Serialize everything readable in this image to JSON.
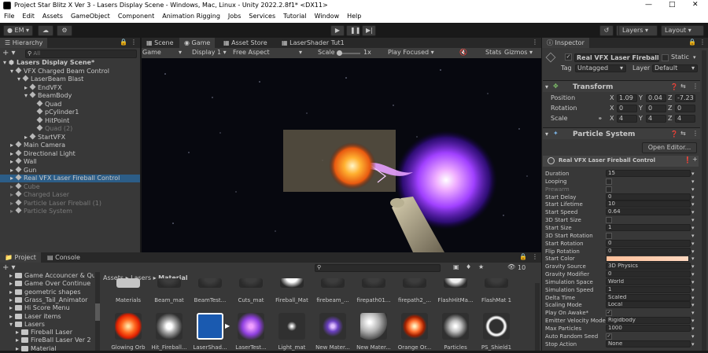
{
  "window": {
    "title": "Project Star Blitz X Ver 3 - Lasers Display Scene - Windows, Mac, Linux - Unity 2022.2.8f1* <DX11>"
  },
  "menu": [
    "File",
    "Edit",
    "Assets",
    "GameObject",
    "Component",
    "Animation Rigging",
    "Jobs",
    "Services",
    "Tutorial",
    "Window",
    "Help"
  ],
  "toolbar": {
    "account": "EM",
    "layers": "Layers",
    "layout": "Layout"
  },
  "hierarchy": {
    "tab": "Hierarchy",
    "search_placeholder": "All",
    "items": [
      {
        "label": "Lasers Display Scene*",
        "depth": 0,
        "kind": "scene",
        "state": "normal"
      },
      {
        "label": "VFX Charged Beam Control",
        "depth": 1,
        "kind": "object",
        "state": "normal"
      },
      {
        "label": "LaserBeam Blast",
        "depth": 2,
        "kind": "object",
        "state": "normal"
      },
      {
        "label": "EndVFX",
        "depth": 3,
        "kind": "object",
        "state": "normal"
      },
      {
        "label": "BeamBody",
        "depth": 3,
        "kind": "object",
        "state": "normal"
      },
      {
        "label": "Quad",
        "depth": 4,
        "kind": "object",
        "state": "normal"
      },
      {
        "label": "pCylinder1",
        "depth": 4,
        "kind": "object",
        "state": "normal"
      },
      {
        "label": "HitPoint",
        "depth": 4,
        "kind": "object",
        "state": "normal"
      },
      {
        "label": "Quad (2)",
        "depth": 4,
        "kind": "object",
        "state": "dim"
      },
      {
        "label": "StartVFX",
        "depth": 3,
        "kind": "object",
        "state": "normal"
      },
      {
        "label": "Main Camera",
        "depth": 1,
        "kind": "object",
        "state": "normal"
      },
      {
        "label": "Directional Light",
        "depth": 1,
        "kind": "object",
        "state": "normal"
      },
      {
        "label": "Wall",
        "depth": 1,
        "kind": "object",
        "state": "normal"
      },
      {
        "label": "Gun",
        "depth": 1,
        "kind": "object",
        "state": "normal"
      },
      {
        "label": "Real VFX Laser Fireball Control",
        "depth": 1,
        "kind": "object",
        "state": "selected"
      },
      {
        "label": "Cube",
        "depth": 1,
        "kind": "object",
        "state": "dim"
      },
      {
        "label": "Charged Laser",
        "depth": 1,
        "kind": "object",
        "state": "dim"
      },
      {
        "label": "Particle Laser Fireball  (1)",
        "depth": 1,
        "kind": "object",
        "state": "dim"
      },
      {
        "label": "Particle System",
        "depth": 1,
        "kind": "object",
        "state": "dim"
      }
    ]
  },
  "view_tabs": [
    "Scene",
    "Game",
    "Asset Store",
    "LaserShader Tut1"
  ],
  "game_bar": {
    "mode": "Game",
    "display": "Display 1",
    "aspect": "Free Aspect",
    "scale_label": "Scale",
    "scale_value": "1x",
    "play_focused": "Play Focused",
    "stats": "Stats",
    "gizmos": "Gizmos"
  },
  "inspector": {
    "tab": "Inspector",
    "object_name": "Real VFX Laser Fireball Cor",
    "static_label": "Static",
    "tag_label": "Tag",
    "tag_value": "Untagged",
    "layer_label": "Layer",
    "layer_value": "Default",
    "transform": {
      "title": "Transform",
      "rows": [
        {
          "label": "Position",
          "x": "1.09",
          "y": "0.04",
          "z": "-7.23"
        },
        {
          "label": "Rotation",
          "x": "0",
          "y": "0",
          "z": "0"
        },
        {
          "label": "Scale",
          "x": "4",
          "y": "4",
          "z": "4"
        }
      ]
    },
    "particle_system": {
      "title": "Particle System",
      "open_editor": "Open Editor...",
      "sub_title": "Real VFX Laser Fireball Control",
      "props": [
        {
          "label": "Duration",
          "value": "15"
        },
        {
          "label": "Looping",
          "value": ""
        },
        {
          "label": "Prewarm",
          "value": ""
        },
        {
          "label": "Start Delay",
          "value": "0"
        },
        {
          "label": "Start Lifetime",
          "value": "10"
        },
        {
          "label": "Start Speed",
          "value": "0.64"
        },
        {
          "label": "3D Start Size",
          "value": ""
        },
        {
          "label": "Start Size",
          "value": "1"
        },
        {
          "label": "3D Start Rotation",
          "value": ""
        },
        {
          "label": "Start Rotation",
          "value": "0"
        },
        {
          "label": "Flip Rotation",
          "value": "0"
        },
        {
          "label": "Start Color",
          "value": ""
        },
        {
          "label": "Gravity Source",
          "value": "3D Physics"
        },
        {
          "label": "Gravity Modifier",
          "value": "0"
        },
        {
          "label": "Simulation Space",
          "value": "World"
        },
        {
          "label": "Simulation Speed",
          "value": "1"
        },
        {
          "label": "Delta Time",
          "value": "Scaled"
        },
        {
          "label": "Scaling Mode",
          "value": "Local"
        },
        {
          "label": "Play On Awake*",
          "value": ""
        },
        {
          "label": "Emitter Velocity Mode",
          "value": "Rigidbody"
        },
        {
          "label": "Max Particles",
          "value": "1000"
        },
        {
          "label": "Auto Random Seed",
          "value": ""
        },
        {
          "label": "Stop Action",
          "value": "None"
        }
      ]
    }
  },
  "project": {
    "tabs": [
      "Project",
      "Console"
    ],
    "badge": "10",
    "breadcrumb": [
      "Assets",
      "Lasers",
      "Material"
    ],
    "folders": [
      {
        "label": "Game Accouncer & Quo",
        "depth": 1
      },
      {
        "label": "Game Over Continue",
        "depth": 1
      },
      {
        "label": "geometric shapes",
        "depth": 1
      },
      {
        "label": "Grass_Tail_Animator",
        "depth": 1
      },
      {
        "label": "Hi Score Menu",
        "depth": 1
      },
      {
        "label": "Laser items",
        "depth": 1
      },
      {
        "label": "Lasers",
        "depth": 1
      },
      {
        "label": "Fireball Laser",
        "depth": 2
      },
      {
        "label": "FireBall Laser Ver 2",
        "depth": 2
      },
      {
        "label": "Material",
        "depth": 2
      }
    ],
    "assets_row1": [
      "Materials",
      "Beam_mat",
      "BeamTest...",
      "Cuts_mat",
      "Fireball_Mat",
      "firebeam_...",
      "firepath01...",
      "firepath2_...",
      "FlashHitMa...",
      "FlashMat 1"
    ],
    "assets_row2": [
      "Glowing Orb",
      "Hit_Fireball...",
      "LaserShad...",
      "LaserTest...",
      "Light_mat",
      "New Mater...",
      "New Mater...",
      "Orange Or...",
      "Particles",
      "PS_Shield1"
    ]
  }
}
